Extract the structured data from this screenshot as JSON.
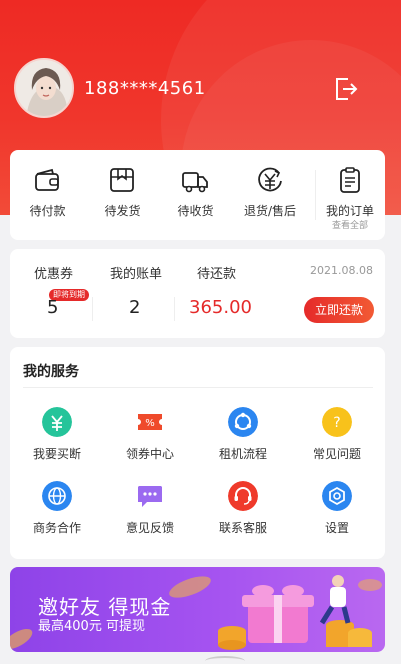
{
  "user": {
    "phone": "188****4561"
  },
  "orders": [
    {
      "label": "待付款",
      "icon": "wallet-icon"
    },
    {
      "label": "待发货",
      "icon": "package-icon"
    },
    {
      "label": "待收货",
      "icon": "truck-icon"
    },
    {
      "label": "退货/售后",
      "icon": "refund-icon"
    },
    {
      "label": "我的订单",
      "sub": "查看全部",
      "icon": "clipboard-icon"
    }
  ],
  "account": {
    "coupon_label": "优惠券",
    "coupon_value": "5",
    "coupon_badge": "即将到期",
    "bill_label": "我的账单",
    "bill_value": "2",
    "repay_label": "待还款",
    "repay_value": "365.00",
    "date": "2021.08.08",
    "repay_button": "立即还款"
  },
  "services": {
    "title": "我的服务",
    "items": [
      {
        "label": "我要买断",
        "icon": "yuan-icon",
        "color": "#25c49a"
      },
      {
        "label": "领券中心",
        "icon": "coupon-icon",
        "color": "#ef4a2b"
      },
      {
        "label": "租机流程",
        "icon": "cycle-icon",
        "color": "#2b86f0"
      },
      {
        "label": "常见问题",
        "icon": "question-icon",
        "color": "#f8c21b"
      },
      {
        "label": "商务合作",
        "icon": "globe-icon",
        "color": "#2b86f0"
      },
      {
        "label": "意见反馈",
        "icon": "chat-icon",
        "color": "#9b6af0"
      },
      {
        "label": "联系客服",
        "icon": "headset-icon",
        "color": "#ef3a2b"
      },
      {
        "label": "设置",
        "icon": "settings-icon",
        "color": "#2b86f0"
      }
    ]
  },
  "banner": {
    "title": "邀好友 得现金",
    "subtitle": "最高400元 可提现"
  },
  "colors": {
    "brand_red": "#ee2a24",
    "banner_purple": "#9a4bec"
  }
}
